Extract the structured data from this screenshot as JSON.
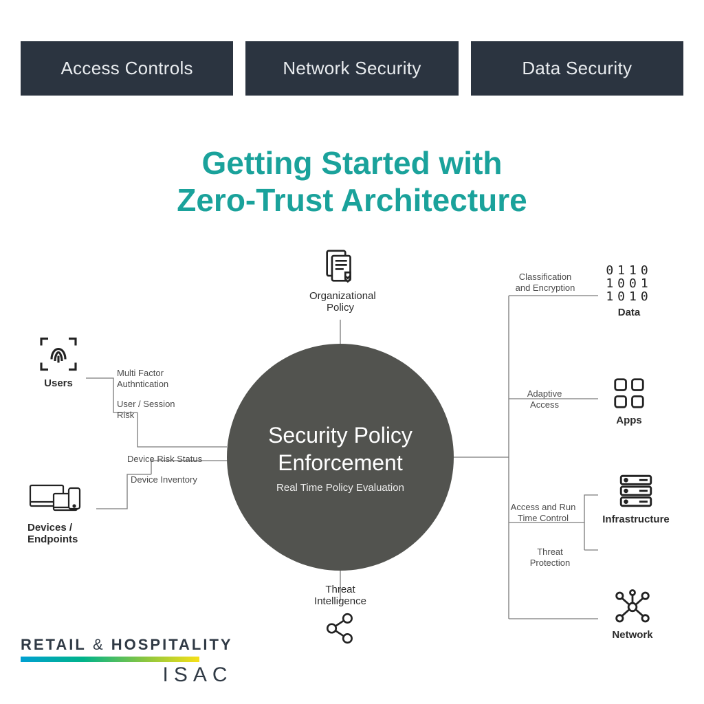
{
  "tabs": [
    "Access Controls",
    "Network Security",
    "Data Security"
  ],
  "headline_l1": "Getting Started with",
  "headline_l2": "Zero-Trust Architecture",
  "hub": {
    "title_l1": "Security Policy",
    "title_l2": "Enforcement",
    "sub": "Real Time Policy Evaluation"
  },
  "nodes": {
    "org_policy": "Organizational Policy",
    "threat_intel": "Threat Intelligence",
    "users": "Users",
    "devices": "Devices / Endpoints",
    "data": "Data",
    "apps": "Apps",
    "infra": "Infrastructure",
    "network": "Network"
  },
  "captions": {
    "mfa": "Multi Factor Authntication",
    "user_risk": "User / Session Risk",
    "dev_risk": "Device Risk Status",
    "dev_inv": "Device Inventory",
    "class_enc": "Classification and Encryption",
    "adaptive": "Adaptive Access",
    "runtime": "Access and Run Time Control",
    "threat_prot": "Threat Protection"
  },
  "data_bits": {
    "r1": "0110",
    "r2": "1001",
    "r3": "1010"
  },
  "logo": {
    "line1_a": "RETAIL",
    "line1_amp": "&",
    "line1_b": "HOSPITALITY",
    "line2": "ISAC"
  }
}
